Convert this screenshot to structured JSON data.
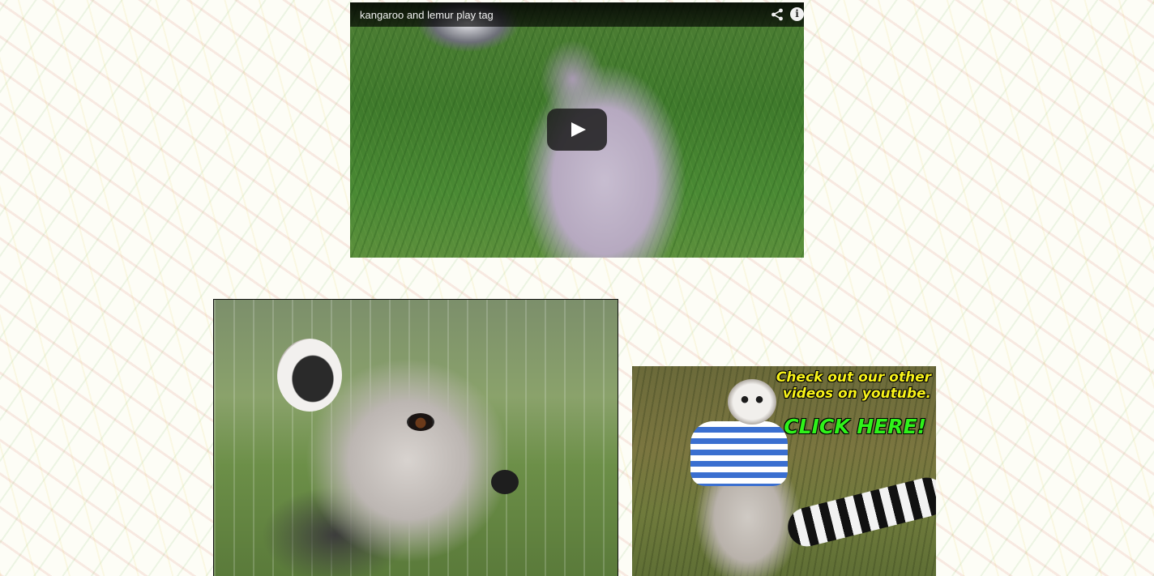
{
  "video": {
    "title": "kangaroo and lemur play tag",
    "icons": [
      "share-icon",
      "info-icon",
      "play-icon"
    ],
    "info_glyph": "i"
  },
  "promo": {
    "line1": "Check out our other",
    "line2": "videos on youtube.",
    "cta": "CLICK HERE!",
    "colors": {
      "text": "#f7f21a",
      "cta": "#2ff21a"
    }
  },
  "photos": {
    "main": "lemur close-up"
  }
}
